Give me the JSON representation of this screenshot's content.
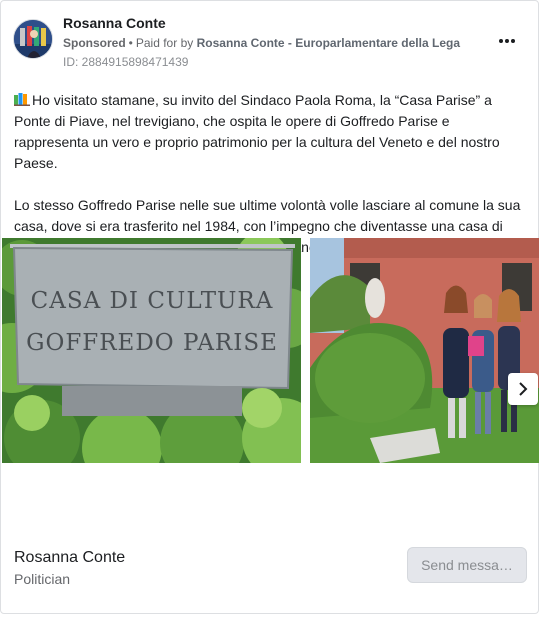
{
  "post": {
    "page_name": "Rosanna Conte",
    "sponsored_label": "Sponsored",
    "separator": "•",
    "paid_for_prefix": "Paid for by",
    "payer": "Rosanna Conte - Europarlamentare della Lega",
    "ad_id": "ID: 2884915898471439",
    "more_icon": "ellipsis-horizontal-icon",
    "body_icon": "books-icon",
    "paragraph_1": "Ho visitato stamane, su invito del Sindaco Paola Roma, la “Casa Parise” a Ponte di Piave, nel trevigiano, che ospita le opere di Goffredo Parise e rappresenta un vero e proprio patrimonio per la cultura del Veneto e del nostro Paese.",
    "paragraph_2": "Lo stesso Goffredo Parise nelle sue ultime volontà volle lasciare al comune la sua casa, dove si era trasferito nel 1984, con l’impegno che diventasse una casa di cultura a lui intestata per studi e per ospitare anche studiosi delle sue opere che…"
  },
  "carousel": {
    "slide_1_sign_line_1": "CASA DI CULTURA",
    "slide_1_sign_line_2": "GOFFREDO PARISE",
    "next_icon": "chevron-right-icon"
  },
  "footer": {
    "page_name": "Rosanna Conte",
    "category": "Politician",
    "cta_label": "Send messa…"
  },
  "colors": {
    "text": "#1c1e21",
    "secondary_text": "#65676b",
    "button_bg": "#e4e6eb",
    "border": "#dddfe2"
  }
}
